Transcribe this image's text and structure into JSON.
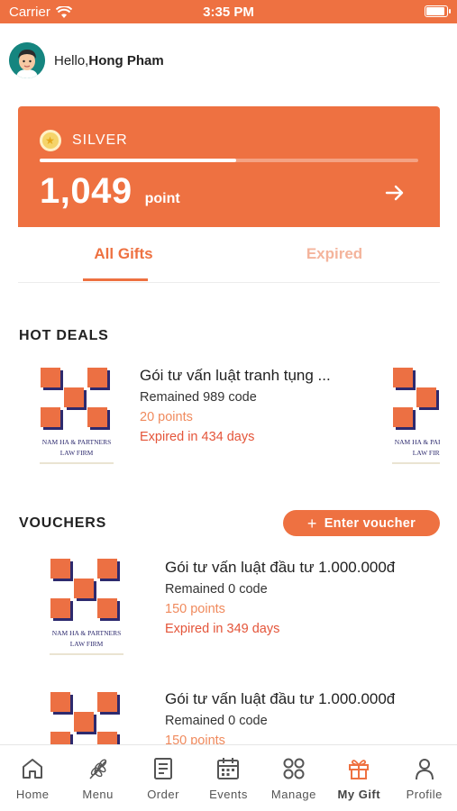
{
  "status_bar": {
    "carrier": "Carrier",
    "time": "3:35 PM"
  },
  "greeting": {
    "prefix": "Hello,",
    "name": "Hong Pham"
  },
  "membership": {
    "tier": "SILVER",
    "points": "1,049",
    "points_unit": "point",
    "progress_fraction": 0.52
  },
  "tabs": [
    {
      "label": "All Gifts"
    },
    {
      "label": "Expired"
    }
  ],
  "hot_deals": {
    "title": "HOT DEALS",
    "items": [
      {
        "logo_text_1": "NAM HA & PARTNERS",
        "logo_text_2": "LAW FIRM",
        "title": "Gói tư vấn luật tranh tụng ...",
        "remained": "Remained 989 code",
        "points": "20 points",
        "expires": "Expired in 434 days"
      }
    ]
  },
  "vouchers": {
    "title": "VOUCHERS",
    "enter_button": "Enter voucher",
    "items": [
      {
        "logo_text_1": "NAM HA & PARTNERS",
        "logo_text_2": "LAW FIRM",
        "title": "Gói tư vấn luật đầu tư 1.000.000đ",
        "remained": "Remained 0 code",
        "points": "150 points",
        "expires": "Expired in 349 days"
      },
      {
        "title": "Gói tư vấn luật đầu tư 1.000.000đ",
        "remained": "Remained 0 code",
        "points": "150 points"
      }
    ]
  },
  "tab_bar": [
    {
      "label": "Home",
      "icon": "home-icon"
    },
    {
      "label": "Menu",
      "icon": "wheat-icon"
    },
    {
      "label": "Order",
      "icon": "document-icon"
    },
    {
      "label": "Events",
      "icon": "calendar-icon"
    },
    {
      "label": "Manage",
      "icon": "grid-circles-icon"
    },
    {
      "label": "My Gift",
      "icon": "gift-icon"
    },
    {
      "label": "Profile",
      "icon": "person-icon"
    }
  ],
  "colors": {
    "accent": "#ee7141",
    "points": "#f08a5d",
    "expire": "#e4553a",
    "status_bar": "#ee7141"
  }
}
